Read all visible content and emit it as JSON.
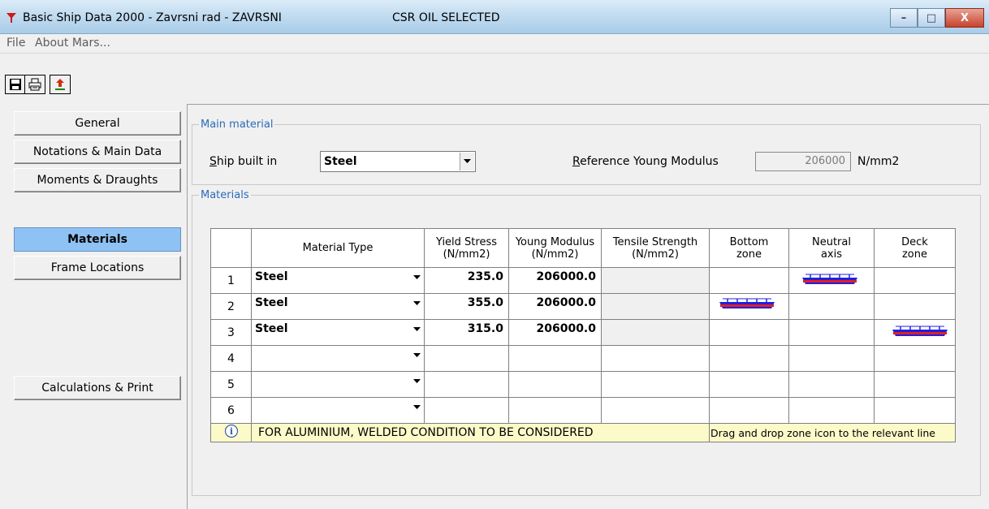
{
  "window": {
    "title": "Basic Ship Data 2000 - Zavrsni rad - ZAVRSNI",
    "status": "CSR OIL SELECTED",
    "minimize": "–",
    "maximize": "□",
    "close": "X"
  },
  "menu": {
    "file": "File",
    "about": "About Mars..."
  },
  "toolbar": {
    "icons": [
      "save-icon",
      "print-icon",
      "export-icon"
    ]
  },
  "sidebar": {
    "items": [
      {
        "label": "General",
        "active": false
      },
      {
        "label": "Notations & Main Data",
        "active": false
      },
      {
        "label": "Moments & Draughts",
        "active": false
      },
      {
        "label": "Materials",
        "active": true
      },
      {
        "label": "Frame Locations",
        "active": false
      },
      {
        "label": "Calculations & Print",
        "active": false
      }
    ]
  },
  "main_material": {
    "legend": "Main material",
    "ship_built_in_label_accel": "S",
    "ship_built_in_label_rest": "hip built in",
    "ship_built_in_value": "Steel",
    "ref_young_label_accel": "R",
    "ref_young_label_rest": "eference Young Modulus",
    "ref_young_value": "206000",
    "ref_young_unit": "N/mm2"
  },
  "materials": {
    "legend": "Materials",
    "columns": {
      "material_type": "Material Type",
      "yield_stress": "Yield Stress",
      "yield_stress_unit": "(N/mm2)",
      "young_modulus": "Young Modulus",
      "young_modulus_unit": "(N/mm2)",
      "tensile_strength": "Tensile Strength",
      "tensile_strength_unit": "(N/mm2)",
      "bottom_zone_1": "Bottom",
      "bottom_zone_2": "zone",
      "neutral_axis_1": "Neutral",
      "neutral_axis_2": "axis",
      "deck_zone_1": "Deck",
      "deck_zone_2": "zone"
    },
    "rows": [
      {
        "num": "1",
        "type": "Steel",
        "yield": "235.0",
        "young": "206000.0",
        "tensile": "",
        "zone": "neutral"
      },
      {
        "num": "2",
        "type": "Steel",
        "yield": "355.0",
        "young": "206000.0",
        "tensile": "",
        "zone": "bottom"
      },
      {
        "num": "3",
        "type": "Steel",
        "yield": "315.0",
        "young": "206000.0",
        "tensile": "",
        "zone": "deck"
      },
      {
        "num": "4",
        "type": "",
        "yield": "",
        "young": "",
        "tensile": "",
        "zone": ""
      },
      {
        "num": "5",
        "type": "",
        "yield": "",
        "young": "",
        "tensile": "",
        "zone": ""
      },
      {
        "num": "6",
        "type": "",
        "yield": "",
        "young": "",
        "tensile": "",
        "zone": ""
      }
    ],
    "info_icon": "i",
    "info_text": "FOR ALUMINIUM, WELDED CONDITION TO BE CONSIDERED",
    "hint_text": "Drag and drop zone icon to the relevant line"
  },
  "colors": {
    "active_tab": "#8fc2f4",
    "legend": "#2a6bb8",
    "info_bg": "#fcfac9",
    "ship_hull": "#2020e0",
    "ship_stripe": "#e02020"
  }
}
